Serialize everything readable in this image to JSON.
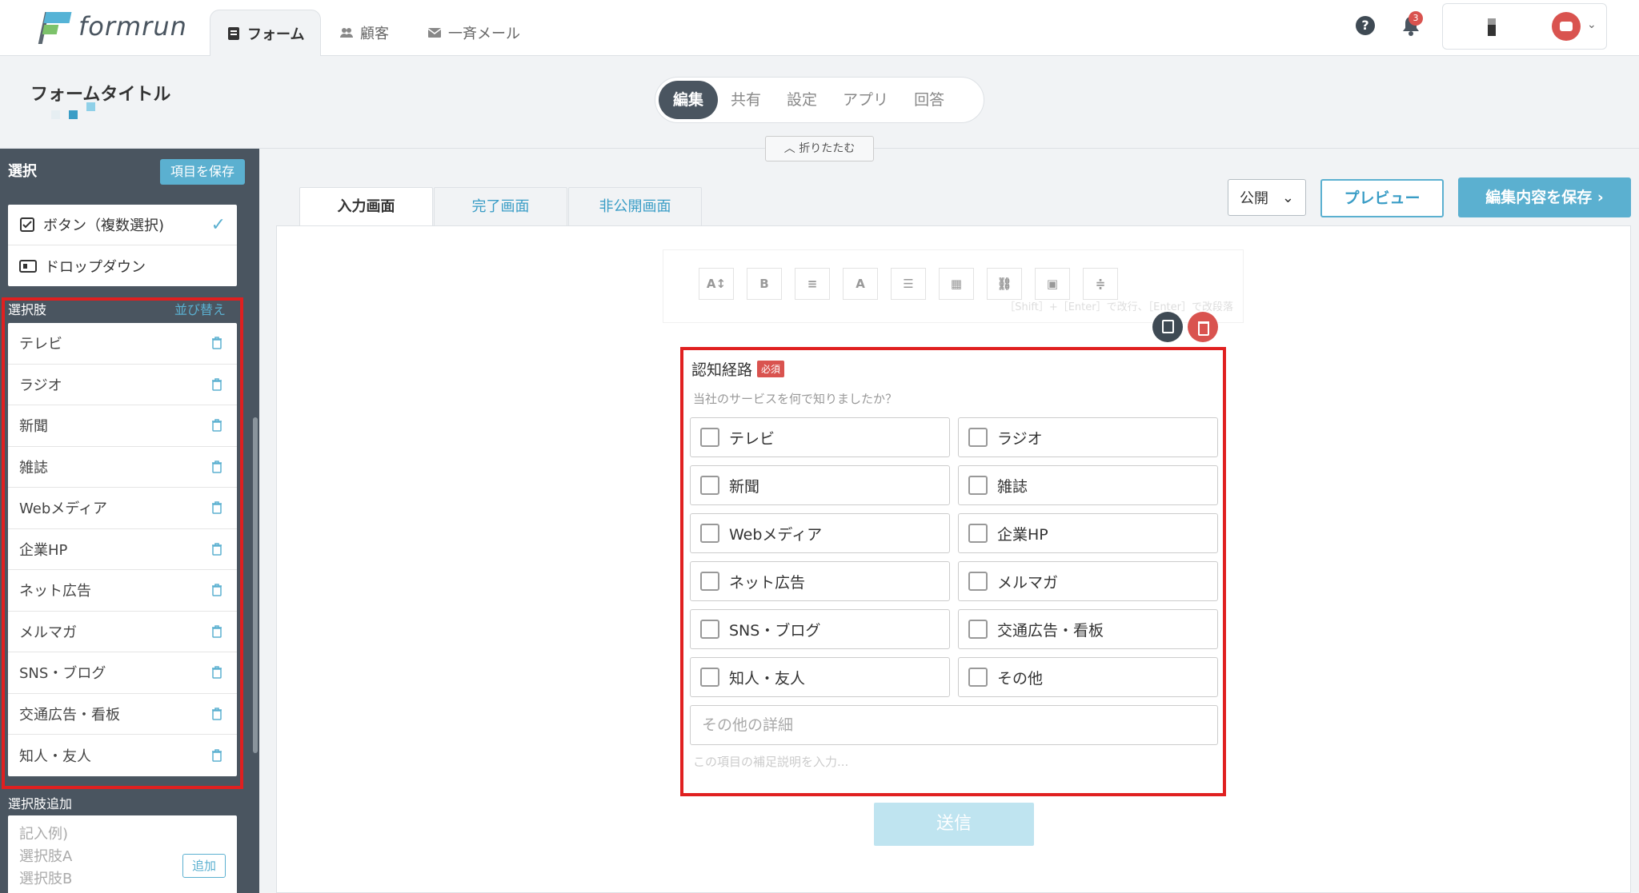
{
  "app": {
    "brand": "formrun",
    "nav": [
      {
        "label": "フォーム",
        "icon": "form-icon"
      },
      {
        "label": "顧客",
        "icon": "users-icon"
      },
      {
        "label": "一斉メール",
        "icon": "mail-icon"
      }
    ],
    "notifications": "3"
  },
  "header": {
    "form_title": "フォームタイトル",
    "mode_tabs": [
      "編集",
      "共有",
      "設定",
      "アプリ",
      "回答"
    ],
    "collapse_label": "折りたたむ"
  },
  "sidebar": {
    "title": "選択",
    "save_label": "項目を保存",
    "types": [
      {
        "label": "ボタン（複数選択)",
        "icon": "checkbox-icon",
        "selected": true
      },
      {
        "label": "ドロップダウン",
        "icon": "dropdown-icon",
        "selected": false
      }
    ],
    "choices_label": "選択肢",
    "sort_label": "並び替え",
    "choices": [
      "テレビ",
      "ラジオ",
      "新聞",
      "雑誌",
      "Webメディア",
      "企業HP",
      "ネット広告",
      "メルマガ",
      "SNS・ブログ",
      "交通広告・看板",
      "知人・友人"
    ],
    "add_label": "選択肢追加",
    "add_placeholder": "記入例)\n選択肢A\n選択肢B",
    "add_button": "追加"
  },
  "main": {
    "screen_tabs": [
      "入力画面",
      "完了画面",
      "非公開画面"
    ],
    "publish_value": "公開",
    "preview_label": "プレビュー",
    "save_label": "編集内容を保存",
    "toolbar_hint": "［Shift］+［Enter］で改行、［Enter］で改段落",
    "toolbar_buttons": [
      "A↕",
      "B",
      "≡",
      "A",
      "☰",
      "▦",
      "⛓",
      "▣",
      "≑"
    ],
    "question": {
      "title": "認知経路",
      "required": "必須",
      "description": "当社のサービスを何で知りましたか？",
      "options": [
        "テレビ",
        "ラジオ",
        "新聞",
        "雑誌",
        "Webメディア",
        "企業HP",
        "ネット広告",
        "メルマガ",
        "SNS・ブログ",
        "交通広告・看板",
        "知人・友人",
        "その他"
      ],
      "other_placeholder": "その他の詳細",
      "help_placeholder": "この項目の補足説明を入力..."
    },
    "submit_label": "送信"
  },
  "colors": {
    "accent": "#5bb0d0",
    "sidebar": "#4a5560",
    "highlight": "#e02020",
    "danger": "#d9534f"
  }
}
